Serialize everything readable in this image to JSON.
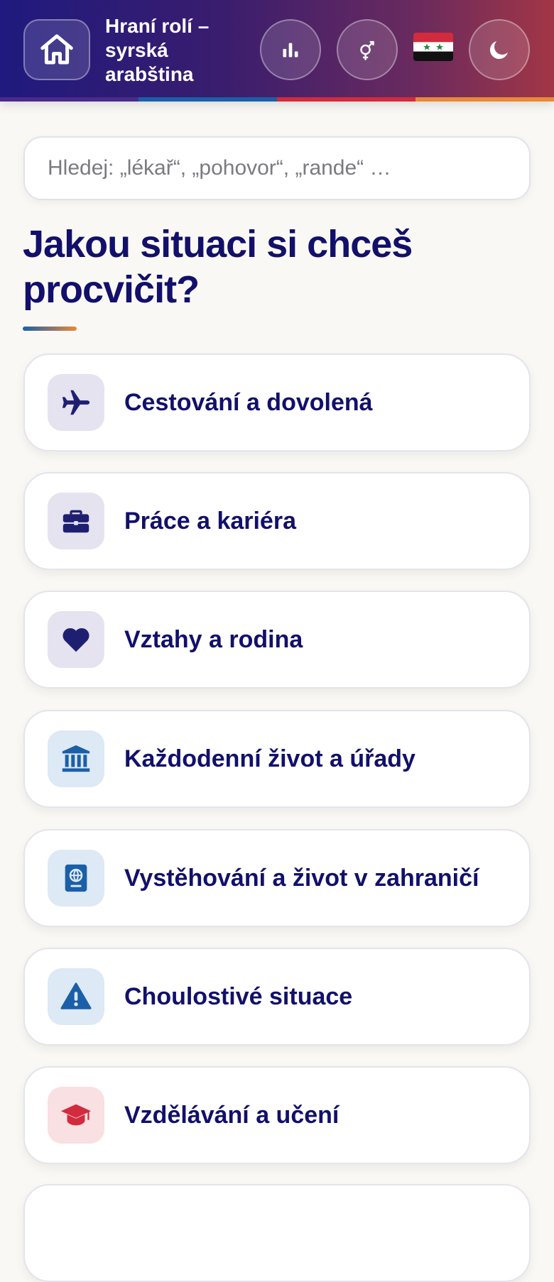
{
  "header": {
    "title": "Hraní rolí – syrská arabština",
    "buttons": [
      "home-icon",
      "bar-chart-icon",
      "gender-icon",
      "syria-flag",
      "moon-icon"
    ]
  },
  "search": {
    "placeholder": "Hledej: „lékař“, „pohovor“, „rande“ …"
  },
  "main": {
    "heading": "Jakou situaci si chceš procvičit?",
    "categories": [
      {
        "label": "Cestování a dovolená",
        "icon": "airplane-icon",
        "icon_bg": "#e4e3ef",
        "icon_color": "#1f1f72"
      },
      {
        "label": "Práce a kariéra",
        "icon": "briefcase-icon",
        "icon_bg": "#e4e3ef",
        "icon_color": "#1f1f72"
      },
      {
        "label": "Vztahy a rodina",
        "icon": "heart-icon",
        "icon_bg": "#e4e3ef",
        "icon_color": "#1f1f72"
      },
      {
        "label": "Každodenní život a úřady",
        "icon": "bank-icon",
        "icon_bg": "#dde9f5",
        "icon_color": "#1b5fa8"
      },
      {
        "label": "Vystěhování a život v zahraničí",
        "icon": "passport-icon",
        "icon_bg": "#dde9f5",
        "icon_color": "#1b5fa8"
      },
      {
        "label": "Choulostivé situace",
        "icon": "warning-icon",
        "icon_bg": "#dde9f5",
        "icon_color": "#1b5fa8"
      },
      {
        "label": "Vzdělávání a učení",
        "icon": "graduation-cap-icon",
        "icon_bg": "#f9e0e2",
        "icon_color": "#d22b3e"
      }
    ]
  },
  "colors": {
    "primary": "#12106b",
    "stripe": [
      "#4a2a8a",
      "#1b5fa8",
      "#d22b3e",
      "#e8893a"
    ]
  }
}
